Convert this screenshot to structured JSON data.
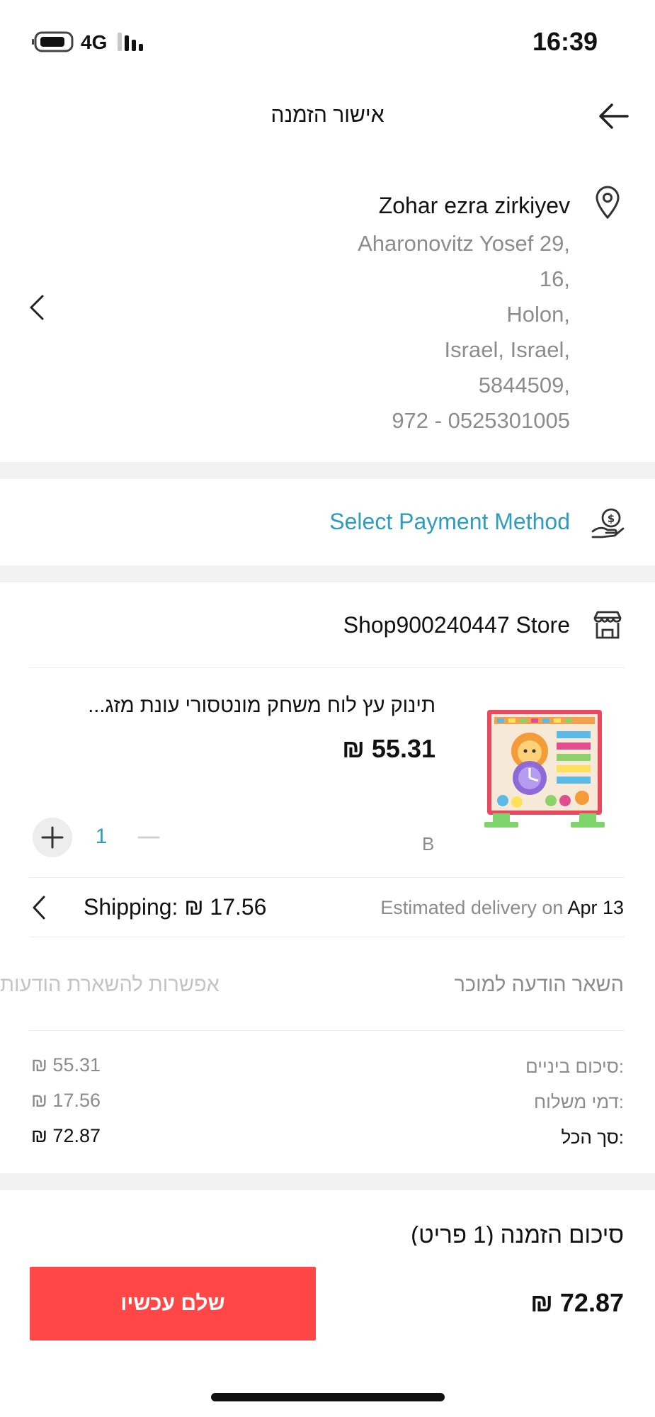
{
  "status_bar": {
    "network": "4G",
    "time": "16:39"
  },
  "header": {
    "title": "אישור הזמנה",
    "back_icon": "arrow-left-icon"
  },
  "address": {
    "name": "Zohar ezra zirkiyev",
    "lines": [
      "Aharonovitz Yosef 29,",
      "16,",
      "Holon,",
      "Israel, Israel,",
      "5844509,",
      "972 - 0525301005"
    ],
    "icon": "location-pin-icon",
    "chevron_icon": "chevron-left-icon"
  },
  "payment": {
    "label": "Select Payment Method",
    "icon": "money-hand-icon",
    "color": "#2e9cbd"
  },
  "store": {
    "name": "Shop900240447 Store",
    "icon": "store-icon"
  },
  "product": {
    "title": "תינוק עץ לוח משחק מונטסורי עונת מזג...",
    "price": "₪ 55.31",
    "variant": "B",
    "quantity": "1",
    "thumbnail": "wooden-calendar-board-image"
  },
  "shipping": {
    "label": "Shipping: ₪ 17.56",
    "delivery_prefix": "Estimated delivery on",
    "delivery_date": "Apr 13"
  },
  "message": {
    "label": "השאר הודעה למוכר",
    "placeholder": "אפשרות להשארת הודעות"
  },
  "summary": {
    "rows": [
      {
        "label": "סיכום ביניים:",
        "value": "₪ 55.31"
      },
      {
        "label": "דמי משלוח:",
        "value": "₪ 17.56"
      },
      {
        "label": "סך הכל:",
        "value": "₪ 72.87"
      }
    ]
  },
  "footer": {
    "order_summary_title": "סיכום הזמנה (1 פריט)",
    "total": "₪ 72.87",
    "pay_button": "שלם עכשיו",
    "pay_button_color": "#ff4747"
  }
}
